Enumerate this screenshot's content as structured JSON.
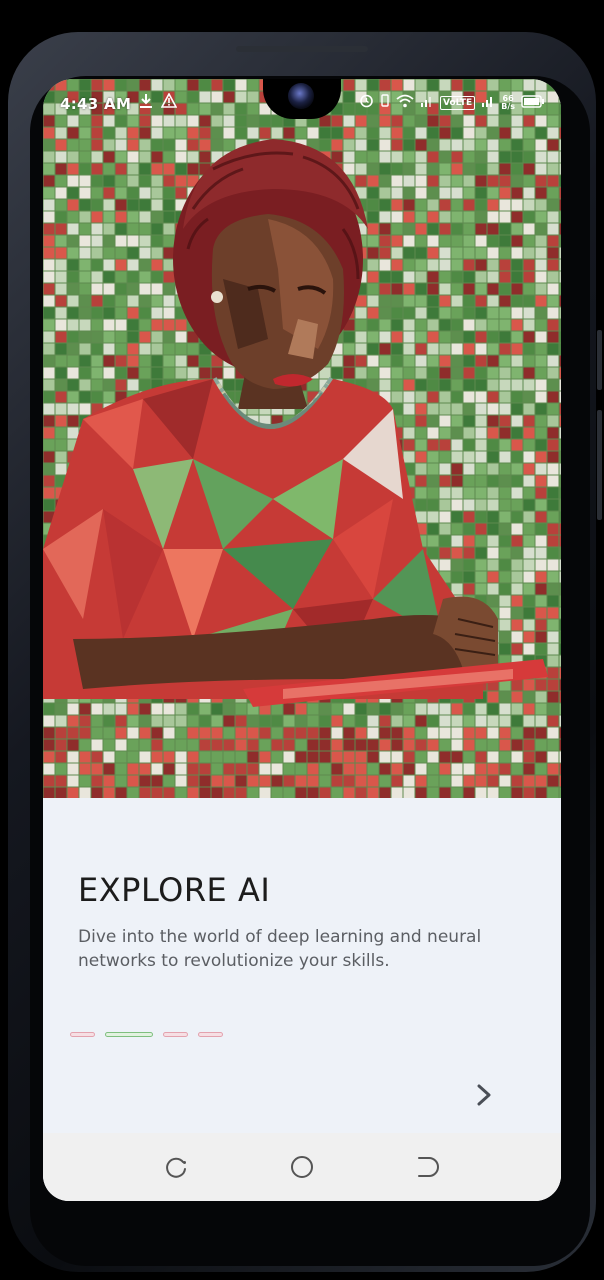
{
  "status_bar": {
    "time": "4:43 AM",
    "left_icons": [
      "download-icon",
      "warning-icon"
    ],
    "right_icons": [
      "alarm-icon",
      "vibrate-icon",
      "wifi-icon",
      "signal-icon",
      "volte-icon",
      "signal-icon",
      "battery-icon"
    ],
    "volte_label": "VoLTE",
    "data_speed": "66",
    "data_speed_unit": "B/s"
  },
  "onboarding": {
    "title": "EXPLORE AI",
    "description": "Dive into the world of deep learning and neural networks to revolutionize your skills.",
    "hero_image": "mosaic-woman-illustration",
    "pages": 4,
    "active_page": 2,
    "next_icon": "chevron-right-icon"
  },
  "colors": {
    "accent_green": "#7fbf7f",
    "indicator_pink": "#e3a2ae",
    "background": "#eef2f8",
    "title": "#1c1c1c",
    "body_text": "#5b5e63"
  },
  "nav_bar": {
    "buttons": [
      "recents-icon",
      "home-icon",
      "back-icon"
    ]
  }
}
